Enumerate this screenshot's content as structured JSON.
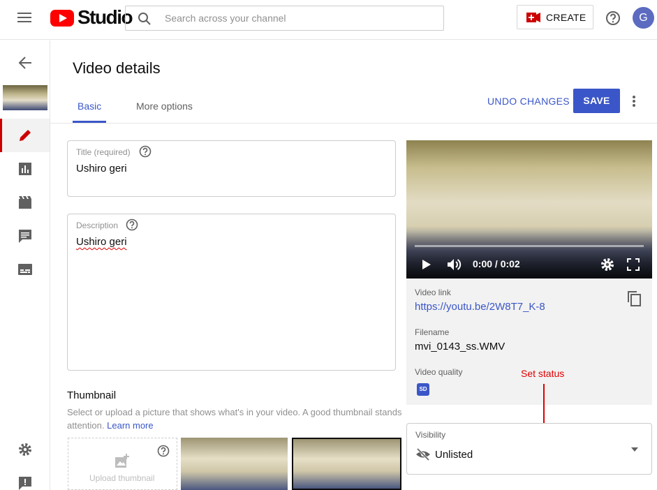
{
  "header": {
    "logo_text": "Studio",
    "search_placeholder": "Search across your channel",
    "create_label": "CREATE",
    "avatar_letter": "G"
  },
  "page": {
    "title": "Video details",
    "tabs": [
      {
        "label": "Basic",
        "active": true
      },
      {
        "label": "More options",
        "active": false
      }
    ],
    "undo_label": "UNDO CHANGES",
    "save_label": "SAVE"
  },
  "form": {
    "title_label": "Title (required)",
    "title_value": "Ushiro geri",
    "description_label": "Description",
    "description_value": "Ushiro geri",
    "thumbnail_heading": "Thumbnail",
    "thumbnail_desc_line1": "Select or upload a picture that shows what's in your video. A good thumbnail stands",
    "thumbnail_desc_line2": "attention.",
    "learn_more": "Learn more",
    "upload_thumbnail": "Upload thumbnail"
  },
  "video": {
    "time": "0:00 / 0:02",
    "link_label": "Video link",
    "link_value": "https://youtu.be/2W8T7_K-8",
    "filename_label": "Filename",
    "filename_value": "mvi_0143_ss.WMV",
    "quality_label": "Video quality",
    "quality_badge": "SD"
  },
  "visibility": {
    "label": "Visibility",
    "value": "Unlisted"
  },
  "annotation": {
    "text": "Set status",
    "color": "#e00000"
  },
  "colors": {
    "accent": "#3a56c8",
    "brand": "#ff0000"
  }
}
